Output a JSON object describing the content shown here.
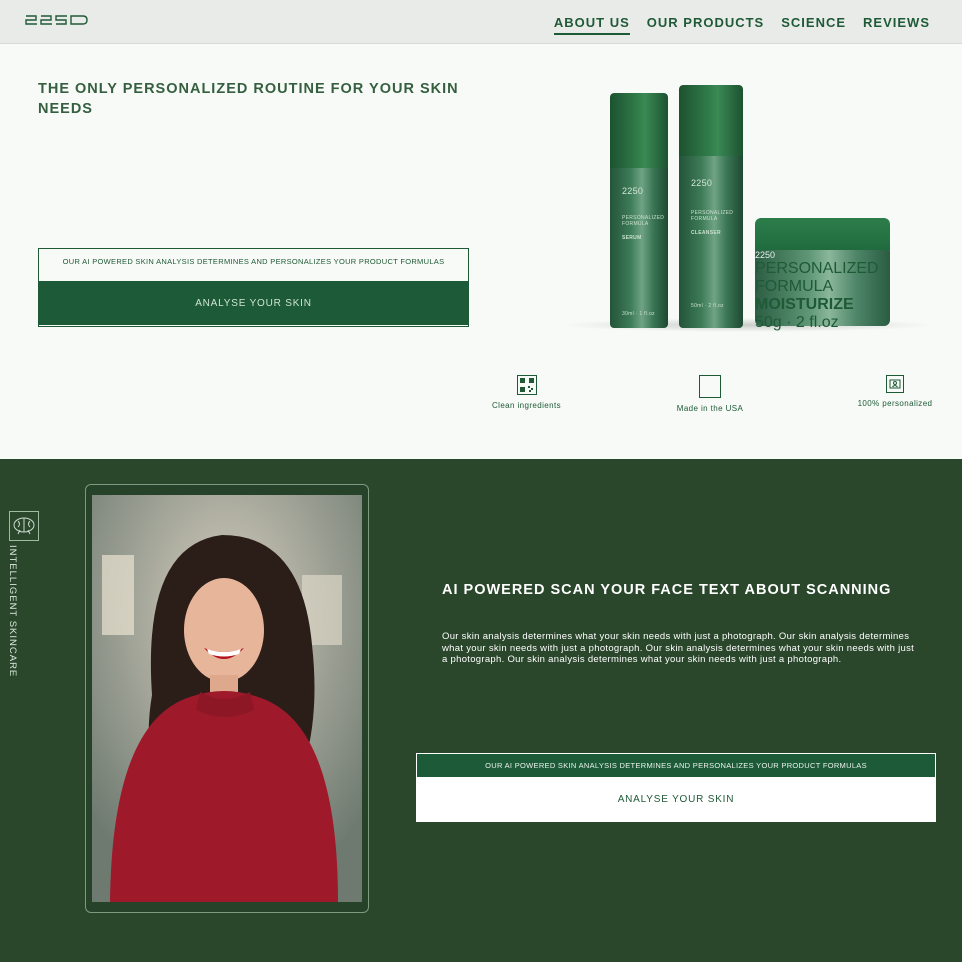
{
  "brand": {
    "logo_text": "2250"
  },
  "nav": {
    "items": [
      {
        "label": "ABOUT US",
        "active": true
      },
      {
        "label": "OUR PRODUCTS",
        "active": false
      },
      {
        "label": "SCIENCE",
        "active": false
      },
      {
        "label": "REVIEWS",
        "active": false
      }
    ]
  },
  "hero": {
    "title": "THE ONLY PERSONALIZED ROUTINE FOR YOUR SKIN NEEDS",
    "cta_note": "OUR AI POWERED SKIN ANALYSIS DETERMINES AND PERSONALIZES YOUR PRODUCT FORMULAS",
    "cta_button": "ANALYSE YOUR SKIN"
  },
  "products": [
    {
      "name": "SERUM",
      "descriptor": "PERSONALIZED FORMULA",
      "size": "30ml · 1 fl.oz"
    },
    {
      "name": "CLEANSER",
      "descriptor": "PERSONALIZED FORMULA",
      "size": "50ml · 2 fl.oz"
    },
    {
      "name": "MOISTURIZE",
      "descriptor": "PERSONALIZED FORMULA",
      "size": "50g · 2 fl.oz"
    }
  ],
  "features": [
    {
      "label": "Clean ingredients",
      "icon": "qr-code-icon"
    },
    {
      "label": "Made in the USA",
      "icon": "flag-icon"
    },
    {
      "label": "100% personalized",
      "icon": "personal-card-icon"
    }
  ],
  "scan_section": {
    "side_label": "INTELLIGENT SKINCARE",
    "side_icon": "brain-icon",
    "title": "AI POWERED SCAN YOUR FACE TEXT ABOUT SCANNING",
    "body": "Our skin analysis determines what your skin needs with just a photograph. Our skin analysis determines what your skin needs with just a photograph. Our skin analysis determines what your skin needs with just a photograph. Our skin analysis determines what your skin needs with just a photograph.",
    "cta_note": "OUR AI POWERED SKIN ANALYSIS DETERMINES AND PERSONALIZES YOUR PRODUCT FORMULAS",
    "cta_button": "ANALYSE YOUR SKIN"
  },
  "colors": {
    "brand_green": "#1d5a38",
    "section_green": "#2a472c",
    "background": "#f7faf6"
  }
}
